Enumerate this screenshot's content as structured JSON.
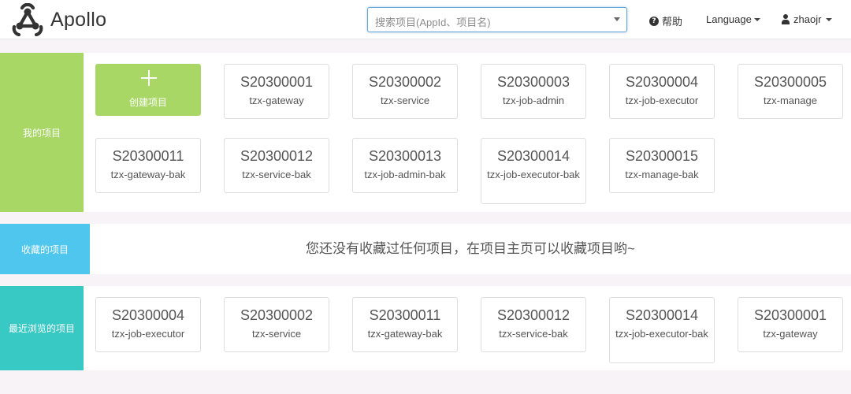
{
  "header": {
    "app_name": "Apollo",
    "search_placeholder": "搜索项目(AppId、项目名)",
    "help": "帮助",
    "language": "Language",
    "user": "zhaojr"
  },
  "sections": {
    "mine_label": "我的项目",
    "favorites_label": "收藏的项目",
    "recent_label": "最近浏览的项目",
    "favorites_empty": "您还没有收藏过任何项目，在项目主页可以收藏项目哟~"
  },
  "create_label": "创建项目",
  "my_projects": [
    {
      "id": "S20300001",
      "name": "tzx-gateway"
    },
    {
      "id": "S20300002",
      "name": "tzx-service"
    },
    {
      "id": "S20300003",
      "name": "tzx-job-admin"
    },
    {
      "id": "S20300004",
      "name": "tzx-job-executor"
    },
    {
      "id": "S20300005",
      "name": "tzx-manage"
    },
    {
      "id": "S20300011",
      "name": "tzx-gateway-bak"
    },
    {
      "id": "S20300012",
      "name": "tzx-service-bak"
    },
    {
      "id": "S20300013",
      "name": "tzx-job-admin-bak"
    },
    {
      "id": "S20300014",
      "name": "tzx-job-executor-bak"
    },
    {
      "id": "S20300015",
      "name": "tzx-manage-bak"
    }
  ],
  "recent_projects": [
    {
      "id": "S20300004",
      "name": "tzx-job-executor"
    },
    {
      "id": "S20300002",
      "name": "tzx-service"
    },
    {
      "id": "S20300011",
      "name": "tzx-gateway-bak"
    },
    {
      "id": "S20300012",
      "name": "tzx-service-bak"
    },
    {
      "id": "S20300014",
      "name": "tzx-job-executor-bak"
    },
    {
      "id": "S20300001",
      "name": "tzx-gateway"
    }
  ]
}
